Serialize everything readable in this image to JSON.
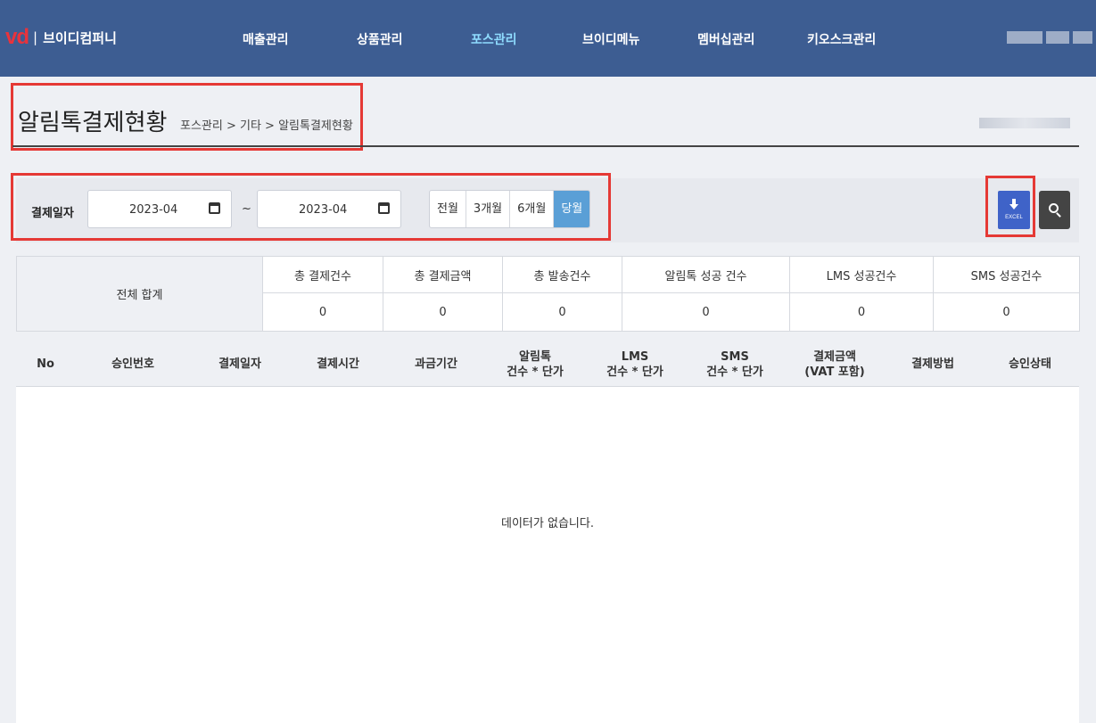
{
  "brand": {
    "logo": "vd",
    "separator": "|",
    "name": "브이디컴퍼니"
  },
  "nav": [
    {
      "label": "매출관리",
      "active": false
    },
    {
      "label": "상품관리",
      "active": false
    },
    {
      "label": "포스관리",
      "active": true
    },
    {
      "label": "브이디메뉴",
      "active": false
    },
    {
      "label": "멤버십관리",
      "active": false
    },
    {
      "label": "키오스크관리",
      "active": false
    }
  ],
  "page": {
    "title": "알림톡결제현황",
    "breadcrumb": "포스관리 > 기타 > 알림톡결제현황"
  },
  "filter": {
    "label": "결제일자",
    "start_date": "2023-04",
    "end_date": "2023-04",
    "tilde": "~",
    "ranges": [
      {
        "label": "전월",
        "active": false
      },
      {
        "label": "3개월",
        "active": false
      },
      {
        "label": "6개월",
        "active": false
      },
      {
        "label": "당월",
        "active": true
      }
    ],
    "excel_label": "EXCEL"
  },
  "summary": {
    "total_label": "전체 합계",
    "headers": [
      "총 결제건수",
      "총 결제금액",
      "총 발송건수",
      "알림톡 성공 건수",
      "LMS 성공건수",
      "SMS 성공건수"
    ],
    "values": [
      "0",
      "0",
      "0",
      "0",
      "0",
      "0"
    ]
  },
  "list": {
    "columns": [
      {
        "line1": "No",
        "line2": ""
      },
      {
        "line1": "승인번호",
        "line2": ""
      },
      {
        "line1": "결제일자",
        "line2": ""
      },
      {
        "line1": "결제시간",
        "line2": ""
      },
      {
        "line1": "과금기간",
        "line2": ""
      },
      {
        "line1": "알림톡",
        "line2": "건수 * 단가"
      },
      {
        "line1": "LMS",
        "line2": "건수 * 단가"
      },
      {
        "line1": "SMS",
        "line2": "건수 * 단가"
      },
      {
        "line1": "결제금액",
        "line2": "(VAT 포함)"
      },
      {
        "line1": "결제방법",
        "line2": ""
      },
      {
        "line1": "승인상태",
        "line2": ""
      }
    ],
    "empty_message": "데이터가 없습니다."
  }
}
